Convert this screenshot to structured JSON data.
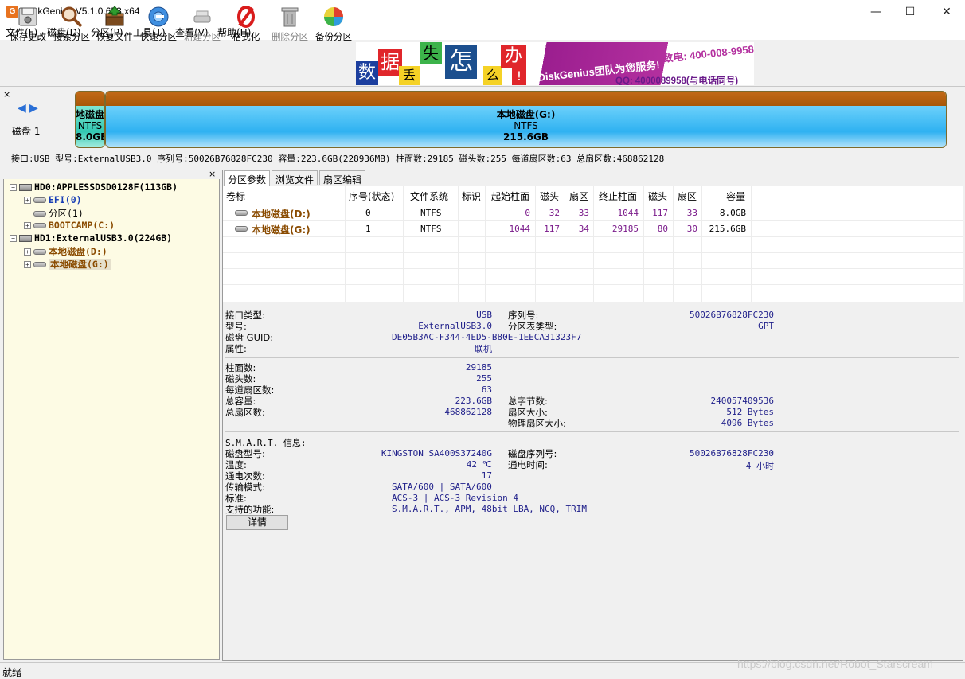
{
  "window": {
    "title": "DiskGenius V5.1.0.653 x64",
    "app_icon": "G",
    "minimize": "—",
    "maximize": "☐",
    "close": "✕"
  },
  "menu": [
    "文件(F)",
    "磁盘(D)",
    "分区(P)",
    "工具(T)",
    "查看(V)",
    "帮助(H)"
  ],
  "toolbar": [
    {
      "label": "保存更改",
      "icon": "save-disk-icon",
      "disabled": false
    },
    {
      "label": "搜索分区",
      "icon": "magnifier-icon",
      "disabled": false
    },
    {
      "label": "恢复文件",
      "icon": "restore-box-icon",
      "disabled": false
    },
    {
      "label": "快速分区",
      "icon": "quick-partition-icon",
      "disabled": false
    },
    {
      "label": "新建分区",
      "icon": "new-partition-icon",
      "disabled": true
    },
    {
      "label": "格式化",
      "icon": "format-icon",
      "disabled": false
    },
    {
      "label": "删除分区",
      "icon": "trash-icon",
      "disabled": true
    },
    {
      "label": "备份分区",
      "icon": "backup-pie-icon",
      "disabled": false
    }
  ],
  "banner": {
    "chars": [
      "数",
      "据",
      "丢",
      "失",
      "怎",
      "么",
      "办",
      "!"
    ],
    "brand_text": "DiskGenius团队为您服务!",
    "phone": "致电: 400-008-9958",
    "qq": "QQ: 4000089958(与电话同号)"
  },
  "diskmap": {
    "close": "×",
    "disk_label": "磁盘 1",
    "nav_left": "◀",
    "nav_right": "▶",
    "partitions": [
      {
        "name": "地磁盘(",
        "fs": "NTFS",
        "size": "8.0GB"
      },
      {
        "name": "本地磁盘(G:)",
        "fs": "NTFS",
        "size": "215.6GB"
      }
    ],
    "info": "接口:USB  型号:ExternalUSB3.0  序列号:50026B76828FC230  容量:223.6GB(228936MB)  柱面数:29185  磁头数:255  每道扇区数:63  总扇区数:468862128"
  },
  "tree": {
    "close": "×",
    "items": [
      {
        "label": "HD0:APPLESSDSD0128F(113GB)",
        "level": 0,
        "type": "disk",
        "exp": "−"
      },
      {
        "label": "EFI(0)",
        "level": 1,
        "type": "part",
        "exp": "+",
        "color": "#1a3fb5"
      },
      {
        "label": "分区(1)",
        "level": 1,
        "type": "part",
        "exp": "",
        "color": "#000000"
      },
      {
        "label": "BOOTCAMP(C:)",
        "level": 1,
        "type": "part",
        "exp": "+",
        "color": "#8a4b00"
      },
      {
        "label": "HD1:ExternalUSB3.0(224GB)",
        "level": 0,
        "type": "disk",
        "exp": "−"
      },
      {
        "label": "本地磁盘(D:)",
        "level": 1,
        "type": "part",
        "exp": "+",
        "color": "#8a4b00"
      },
      {
        "label": "本地磁盘(G:)",
        "level": 1,
        "type": "part",
        "exp": "+",
        "color": "#8a4b00",
        "selected": true
      }
    ]
  },
  "tabs": [
    "分区参数",
    "浏览文件",
    "扇区编辑"
  ],
  "table": {
    "headers": [
      "卷标",
      "序号(状态)",
      "文件系统",
      "标识",
      "起始柱面",
      "磁头",
      "扇区",
      "终止柱面",
      "磁头",
      "扇区",
      "容量"
    ],
    "rows": [
      [
        "本地磁盘(D:)",
        "0",
        "NTFS",
        "",
        "0",
        "32",
        "33",
        "1044",
        "117",
        "33",
        "8.0GB"
      ],
      [
        "本地磁盘(G:)",
        "1",
        "NTFS",
        "",
        "1044",
        "117",
        "34",
        "29185",
        "80",
        "30",
        "215.6GB"
      ]
    ]
  },
  "details": {
    "interface_label": "接口类型:",
    "interface": "USB",
    "serial_label": "序列号:",
    "serial": "50026B76828FC230",
    "model_label": "型号:",
    "model": "ExternalUSB3.0",
    "pt_label": "分区表类型:",
    "pt": "GPT",
    "guid_label": "磁盘 GUID:",
    "guid": "DE05B3AC-F344-4ED5-B80E-1EECA31323F7",
    "attr_label": "属性:",
    "attr": "联机",
    "cyl_label": "柱面数:",
    "cyl": "29185",
    "heads_label": "磁头数:",
    "heads": "255",
    "spt_label": "每道扇区数:",
    "spt": "63",
    "cap_label": "总容量:",
    "cap": "223.6GB",
    "bytes_label": "总字节数:",
    "bytes": "240057409536",
    "sectors_label": "总扇区数:",
    "sectors": "468862128",
    "sector_size_label": "扇区大小:",
    "sector_size": "512 Bytes",
    "phys_label": "物理扇区大小:",
    "phys": "4096 Bytes",
    "smart_title": "S.M.A.R.T. 信息:",
    "smart_model_label": "磁盘型号:",
    "smart_model": "KINGSTON SA400S37240G",
    "smart_serial_label": "磁盘序列号:",
    "smart_serial": "50026B76828FC230",
    "temp_label": "温度:",
    "temp": "42 ℃",
    "power_time_label": "通电时间:",
    "power_time": "4 小时",
    "power_count_label": "通电次数:",
    "power_count": "17",
    "transfer_label": "传输模式:",
    "transfer": "SATA/600 | SATA/600",
    "standard_label": "标准:",
    "standard": "ACS-3 | ACS-3 Revision 4",
    "features_label": "支持的功能:",
    "features": "S.M.A.R.T., APM, 48bit LBA, NCQ, TRIM",
    "detail_button": "详情"
  },
  "status": {
    "text": "就绪",
    "watermark": "https://blog.csdn.net/Robot_Starscream"
  },
  "colors": {
    "partition_orange": "#a85808",
    "partition_blue": "#2fb1f1",
    "tree_bg": "#fdfbe4",
    "volume_text": "#8a4b00"
  }
}
